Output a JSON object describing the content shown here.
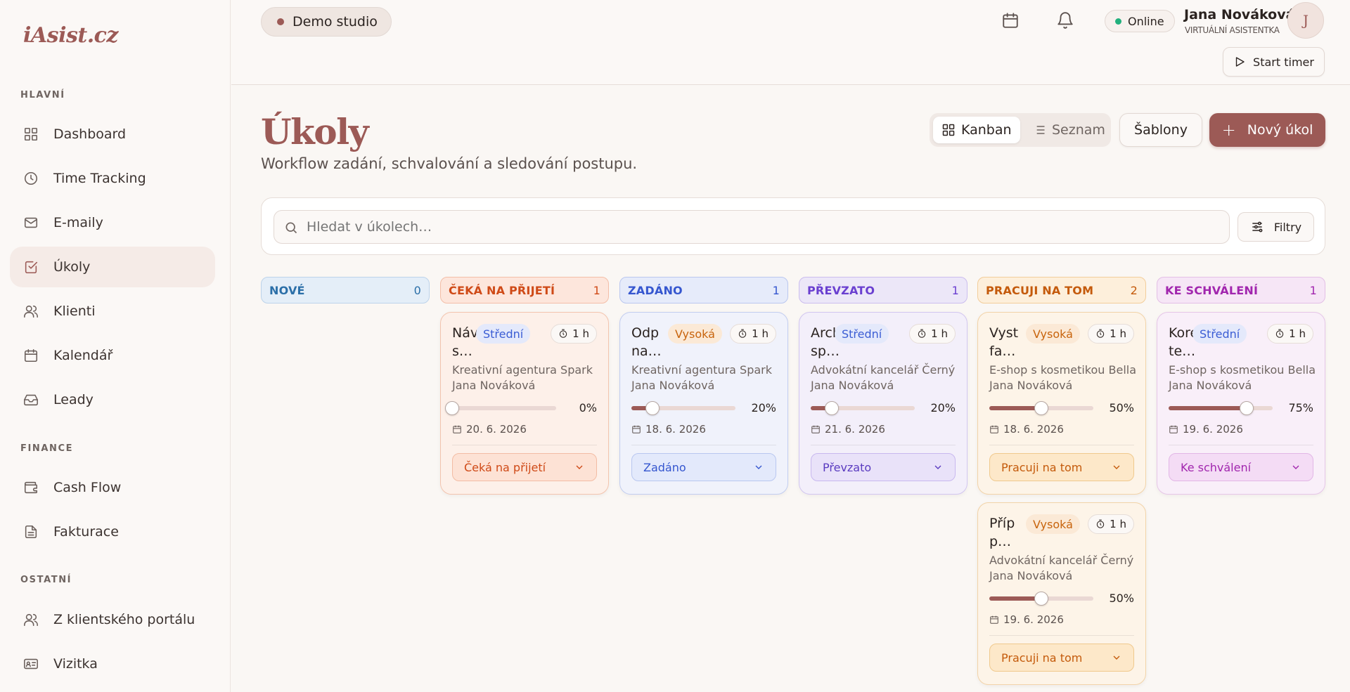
{
  "brand": {
    "logo": "iAsist.cz"
  },
  "sidebar": {
    "sections": [
      {
        "label": "HLAVNÍ"
      },
      {
        "label": "FINANCE"
      },
      {
        "label": "OSTATNÍ"
      }
    ],
    "items": [
      {
        "label": "Dashboard",
        "icon": "grid-icon"
      },
      {
        "label": "Time Tracking",
        "icon": "clock-icon"
      },
      {
        "label": "E-maily",
        "icon": "mail-icon"
      },
      {
        "label": "Úkoly",
        "icon": "check-square-icon",
        "active": true
      },
      {
        "label": "Klienti",
        "icon": "users-icon"
      },
      {
        "label": "Kalendář",
        "icon": "calendar-icon"
      },
      {
        "label": "Leady",
        "icon": "inbox-icon"
      },
      {
        "label": "Cash Flow",
        "icon": "wallet-icon"
      },
      {
        "label": "Fakturace",
        "icon": "file-icon"
      },
      {
        "label": "Z klientského portálu",
        "icon": "users-icon"
      },
      {
        "label": "Vizitka",
        "icon": "id-card-icon"
      }
    ]
  },
  "topbar": {
    "studio": "Demo studio",
    "status": "Online",
    "user_name": "Jana Nováková",
    "user_role": "VIRTUÁLNÍ ASISTENTKA",
    "avatar_initial": "J",
    "timer_label": "Start timer"
  },
  "page": {
    "title": "Úkoly",
    "subtitle": "Workflow zadání, schvalování a sledování postupu.",
    "view_kanban": "Kanban",
    "view_list": "Seznam",
    "templates": "Šablony",
    "new_task": "Nový úkol",
    "search_placeholder": "Hledat v úkolech…",
    "filters": "Filtry"
  },
  "colors": {
    "accent": "#9c5a56",
    "online": "#22b07d"
  },
  "columns": [
    {
      "title": "NOVÉ",
      "count": "0"
    },
    {
      "title": "ČEKÁ NA PŘIJETÍ",
      "count": "1"
    },
    {
      "title": "ZADÁNO",
      "count": "1"
    },
    {
      "title": "PŘEVZATO",
      "count": "1"
    },
    {
      "title": "PRACUJI NA TOM",
      "count": "2"
    },
    {
      "title": "KE SCHVÁLENÍ",
      "count": "1"
    }
  ],
  "cards": [
    {
      "title1": "Návi",
      "title2": "s…",
      "priority": "Střední",
      "estimate": "1 h",
      "client": "Kreativní agentura Spark",
      "assignee": "Jana Nováková",
      "progress": 0,
      "progress_label": "0%",
      "due": "20. 6. 2026",
      "status": "Čeká na přijetí"
    },
    {
      "title1": "Odp",
      "title2": "na…",
      "priority": "Vysoká",
      "estimate": "1 h",
      "client": "Kreativní agentura Spark",
      "assignee": "Jana Nováková",
      "progress": 20,
      "progress_label": "20%",
      "due": "18. 6. 2026",
      "status": "Zadáno"
    },
    {
      "title1": "Arch",
      "title2": "sp…",
      "priority": "Střední",
      "estimate": "1 h",
      "client": "Advokátní kancelář Černý",
      "assignee": "Jana Nováková",
      "progress": 20,
      "progress_label": "20%",
      "due": "21. 6. 2026",
      "status": "Převzato"
    },
    {
      "title1": "Vyst",
      "title2": "fa…",
      "priority": "Vysoká",
      "estimate": "1 h",
      "client": "E-shop s kosmetikou Bella",
      "assignee": "Jana Nováková",
      "progress": 50,
      "progress_label": "50%",
      "due": "18. 6. 2026",
      "status": "Pracuji na tom"
    },
    {
      "title1": "Příp",
      "title2": "p…",
      "priority": "Vysoká",
      "estimate": "1 h",
      "client": "Advokátní kancelář Černý",
      "assignee": "Jana Nováková",
      "progress": 50,
      "progress_label": "50%",
      "due": "19. 6. 2026",
      "status": "Pracuji na tom"
    },
    {
      "title1": "Kore",
      "title2": "te…",
      "priority": "Střední",
      "estimate": "1 h",
      "client": "E-shop s kosmetikou Bella",
      "assignee": "Jana Nováková",
      "progress": 75,
      "progress_label": "75%",
      "due": "19. 6. 2026",
      "status": "Ke schválení"
    }
  ]
}
